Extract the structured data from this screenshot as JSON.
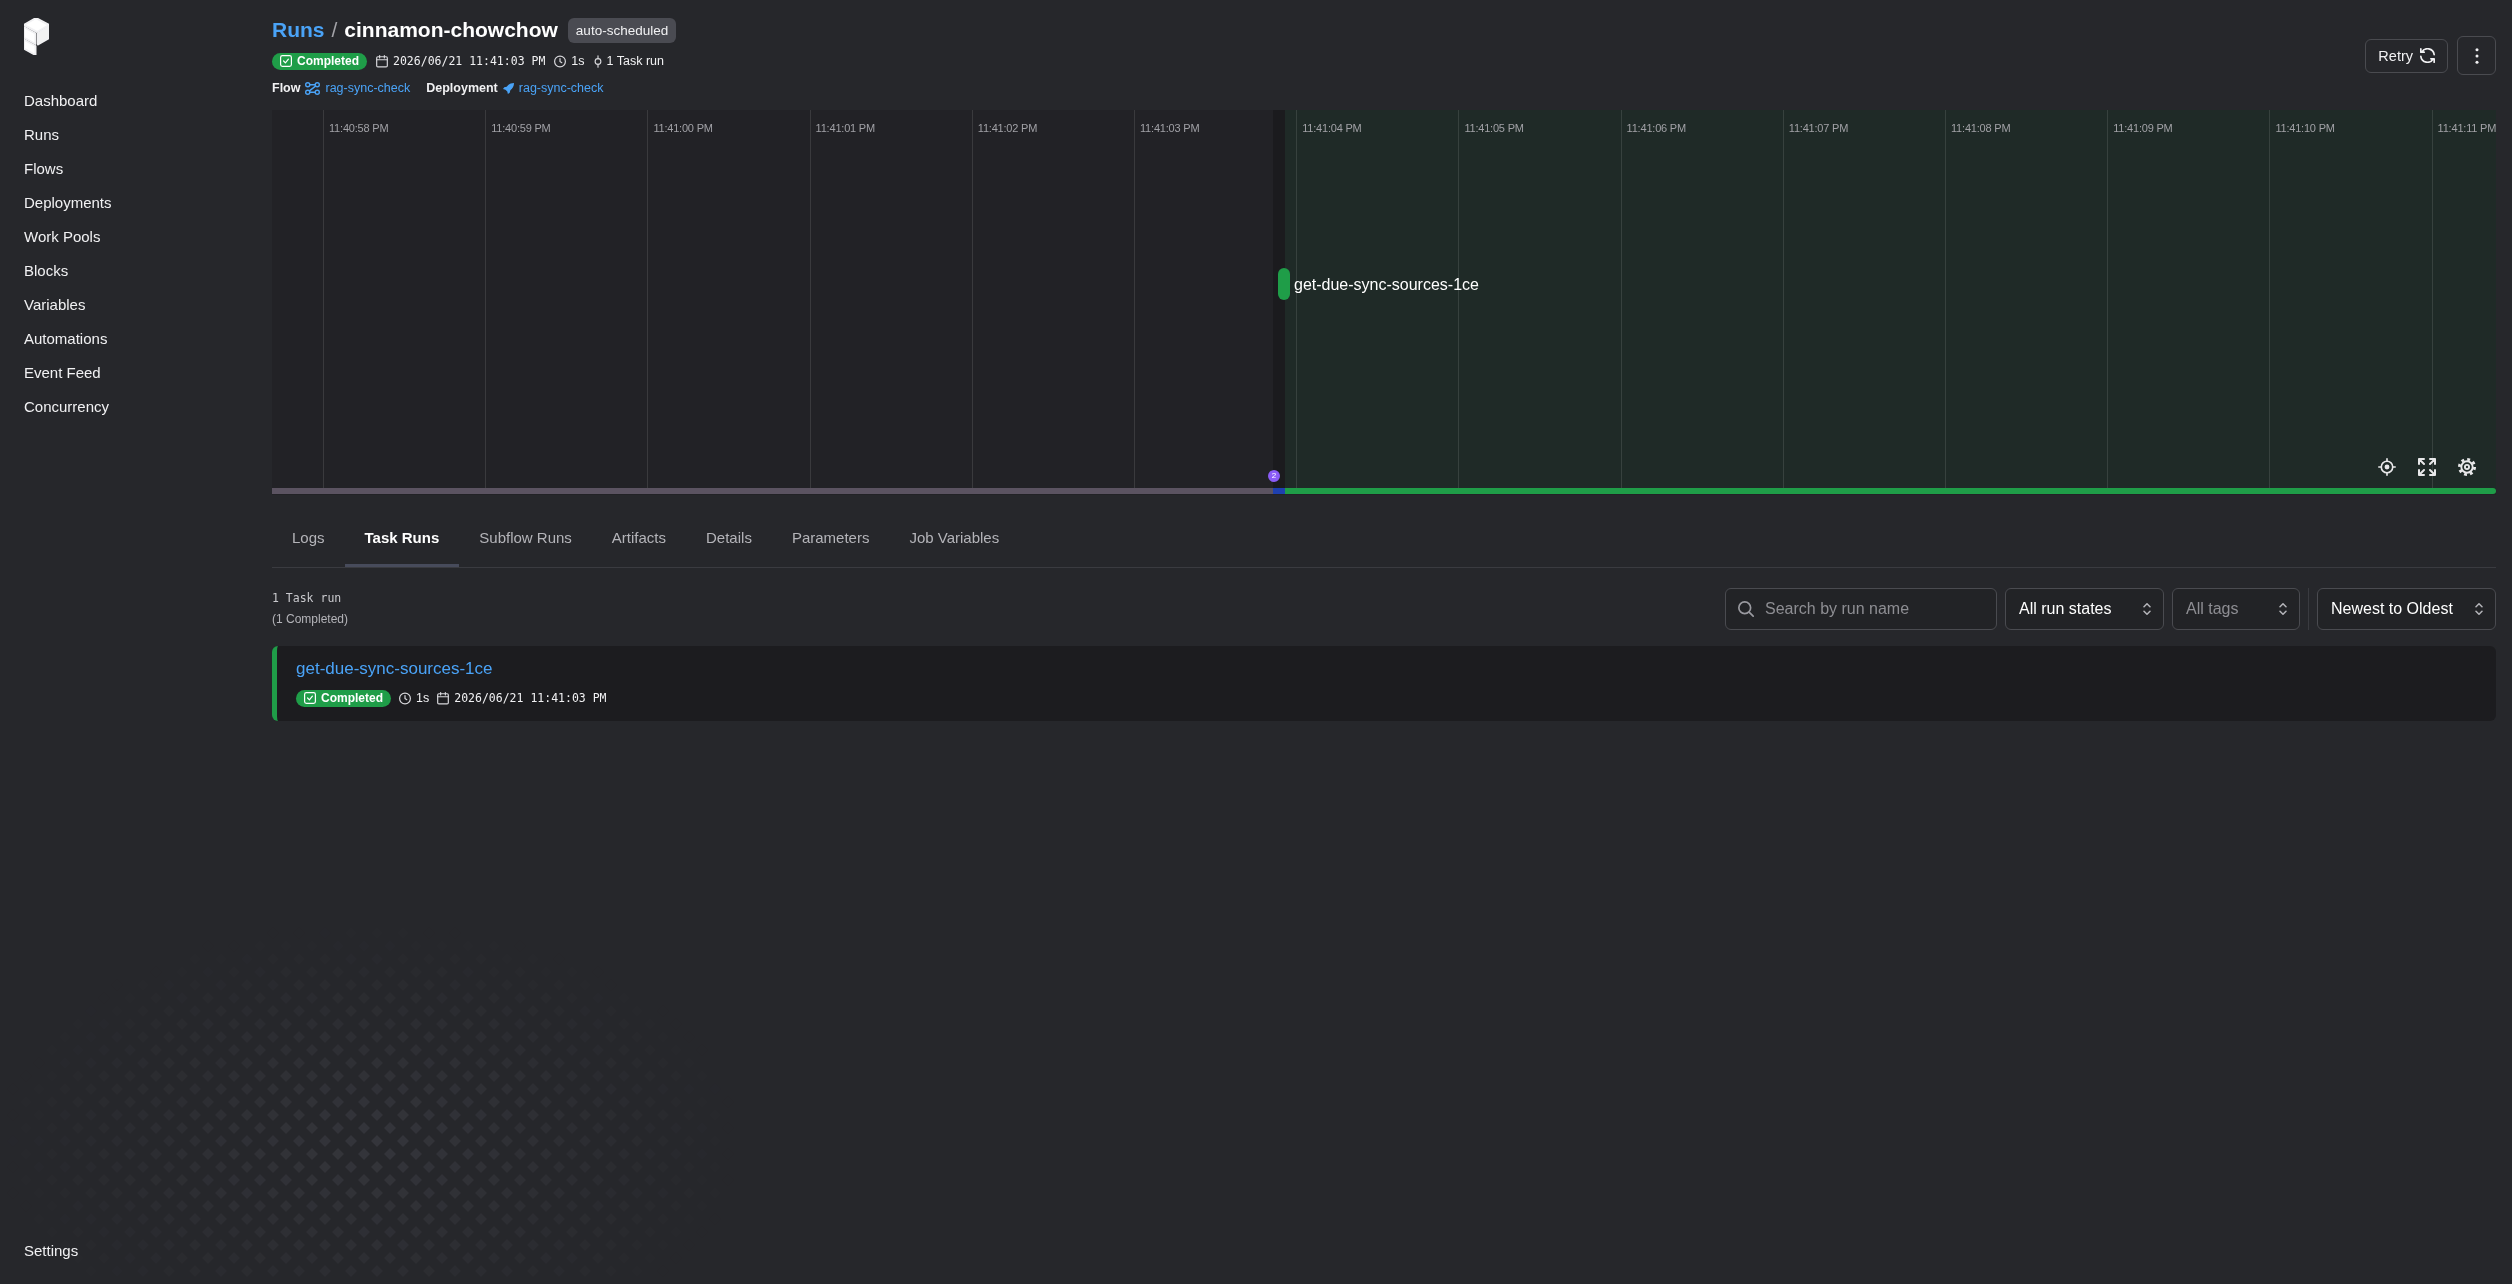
{
  "sidebar": {
    "items": [
      {
        "label": "Dashboard"
      },
      {
        "label": "Runs"
      },
      {
        "label": "Flows"
      },
      {
        "label": "Deployments"
      },
      {
        "label": "Work Pools"
      },
      {
        "label": "Blocks"
      },
      {
        "label": "Variables"
      },
      {
        "label": "Automations"
      },
      {
        "label": "Event Feed"
      },
      {
        "label": "Concurrency"
      }
    ],
    "footer_items": [
      {
        "label": "Settings"
      }
    ]
  },
  "header": {
    "breadcrumb": [
      {
        "label": "Runs",
        "kind": "link"
      },
      {
        "label": "cinnamon-chowchow",
        "kind": "current"
      }
    ],
    "separator": "/",
    "tag": "auto-scheduled",
    "state": {
      "label": "Completed",
      "kind": "completed"
    },
    "start_time": "2026/06/21 11:41:03 PM",
    "duration": "1s",
    "task_runs": "1 Task run",
    "flow": {
      "label": "Flow",
      "value": "rag-sync-check"
    },
    "deployment": {
      "label": "Deployment",
      "value": "rag-sync-check"
    }
  },
  "actions": {
    "retry": "Retry"
  },
  "timeline": {
    "ticks": [
      "11:40:58 PM",
      "11:40:59 PM",
      "11:41:00 PM",
      "11:41:01 PM",
      "11:41:02 PM",
      "11:41:03 PM",
      "11:41:04 PM",
      "11:41:05 PM",
      "11:41:06 PM",
      "11:41:07 PM",
      "11:41:08 PM",
      "11:41:09 PM",
      "11:41:10 PM",
      "11:41:11 PM"
    ],
    "nodes": [
      {
        "label": "get-due-sync-sources-1ce",
        "kind": "completed"
      }
    ],
    "event_count": "2"
  },
  "tabs": [
    {
      "label": "Logs",
      "selected": false
    },
    {
      "label": "Task Runs",
      "selected": true
    },
    {
      "label": "Subflow Runs",
      "selected": false
    },
    {
      "label": "Artifacts",
      "selected": false
    },
    {
      "label": "Details",
      "selected": false
    },
    {
      "label": "Parameters",
      "selected": false
    },
    {
      "label": "Job Variables",
      "selected": false
    }
  ],
  "task_runs": {
    "count": "1 Task run",
    "summary": "(1 Completed)",
    "search": {
      "placeholder": "Search by run name"
    },
    "state_filter": {
      "value": "All run states"
    },
    "tag_filter": {
      "placeholder": "All tags"
    },
    "sort": {
      "value": "Newest to Oldest"
    },
    "rows": [
      {
        "name": "get-due-sync-sources-1ce",
        "state": {
          "label": "Completed",
          "kind": "completed"
        },
        "duration": "1s",
        "start_time": "2026/06/21 11:41:03 PM"
      }
    ]
  }
}
